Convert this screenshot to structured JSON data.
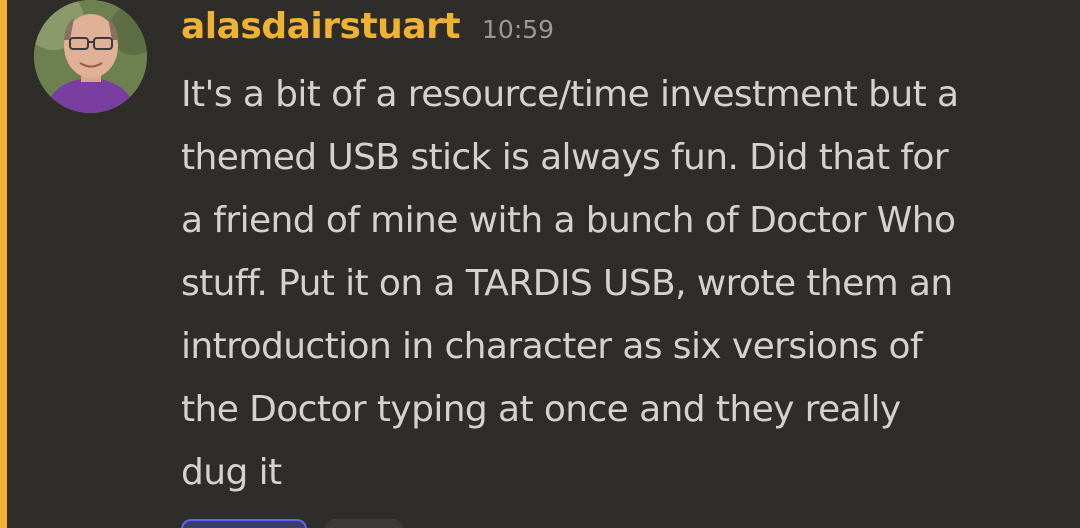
{
  "message": {
    "author": "alasdairstuart",
    "timestamp": "10:59",
    "text": "It's a bit of a resource/time investment but a\nthemed USB stick is always fun. Did that for\na friend of mine with a bunch of Doctor Who\nstuff. Put it on a TARDIS USB, wrote them an\nintroduction in character as six versions of\nthe Doctor typing at once and they really\ndug it"
  },
  "colors": {
    "background": "#2e2d2a",
    "highlight": "#f0b232",
    "username": "#f0b232",
    "text": "#d3d2ce",
    "timestamp": "#9a9995",
    "reaction_active_border": "#5865f2"
  }
}
